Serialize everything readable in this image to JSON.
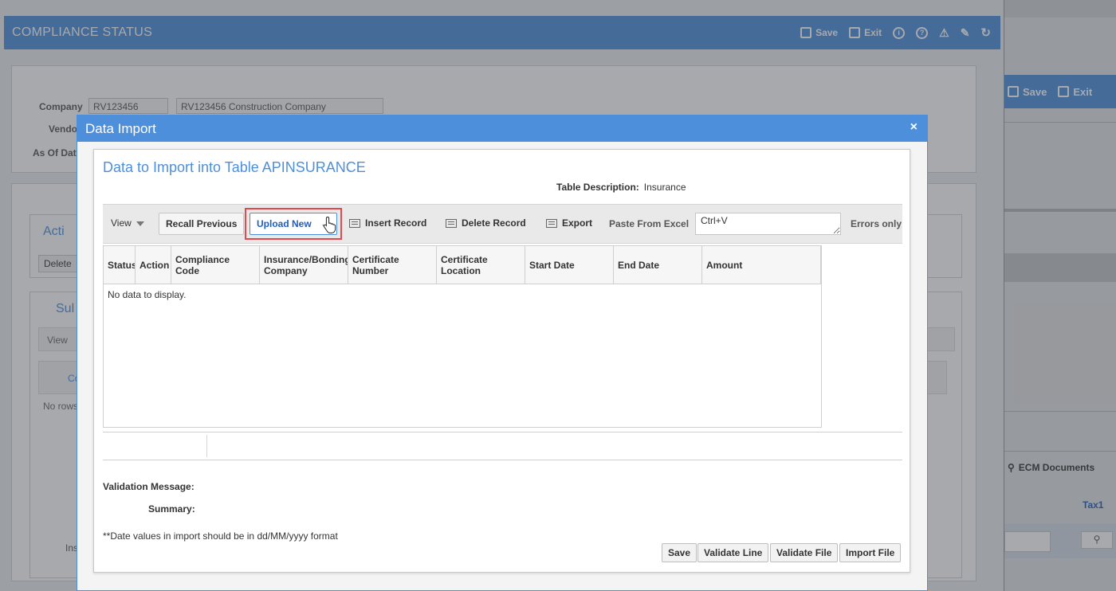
{
  "background": {
    "title": "COMPLIANCE STATUS",
    "header_tools": {
      "save": "Save",
      "exit": "Exit"
    },
    "company_label": "Company",
    "company_code": "RV123456",
    "company_name": "RV123456  Construction Company",
    "vendor_label": "Vendo",
    "as_of_label": "As Of Dat",
    "section_action": "Acti",
    "delete_label": "Delete",
    "section_sub": "Sul",
    "view_label": "View",
    "col_co": "Co",
    "no_rows": "No rows",
    "ins_label": "Ins",
    "right_save": "Save",
    "right_exit": "Exit",
    "ecm_documents": "ECM Documents",
    "tax1": "Tax1"
  },
  "dialog": {
    "title": "Data Import",
    "close_glyph": "×",
    "heading": "Data to Import into Table APINSURANCE",
    "table_description_label": "Table Description:",
    "table_description_value": "Insurance",
    "toolbar": {
      "view": "View",
      "recall_previous": "Recall Previous",
      "upload_new": "Upload New",
      "insert_record": "Insert Record",
      "delete_record": "Delete Record",
      "export": "Export",
      "paste_from_excel": "Paste From Excel",
      "paste_value": "Ctrl+V",
      "errors_only": "Errors only"
    },
    "columns": [
      "Status",
      "Action",
      "Compliance Code",
      "Insurance/Bonding Company",
      "Certificate Number",
      "Certificate Location",
      "Start Date",
      "End Date",
      "Amount"
    ],
    "empty_text": "No data to display.",
    "validation_message_label": "Validation Message:",
    "summary_label": "Summary:",
    "date_note": "**Date values in import should be in dd/MM/yyyy format",
    "buttons": {
      "save": "Save",
      "validate_line": "Validate Line",
      "validate_file": "Validate File",
      "import_file": "Import File"
    },
    "accent_color": "#4e8fdc",
    "highlight_color": "#e5484d"
  }
}
